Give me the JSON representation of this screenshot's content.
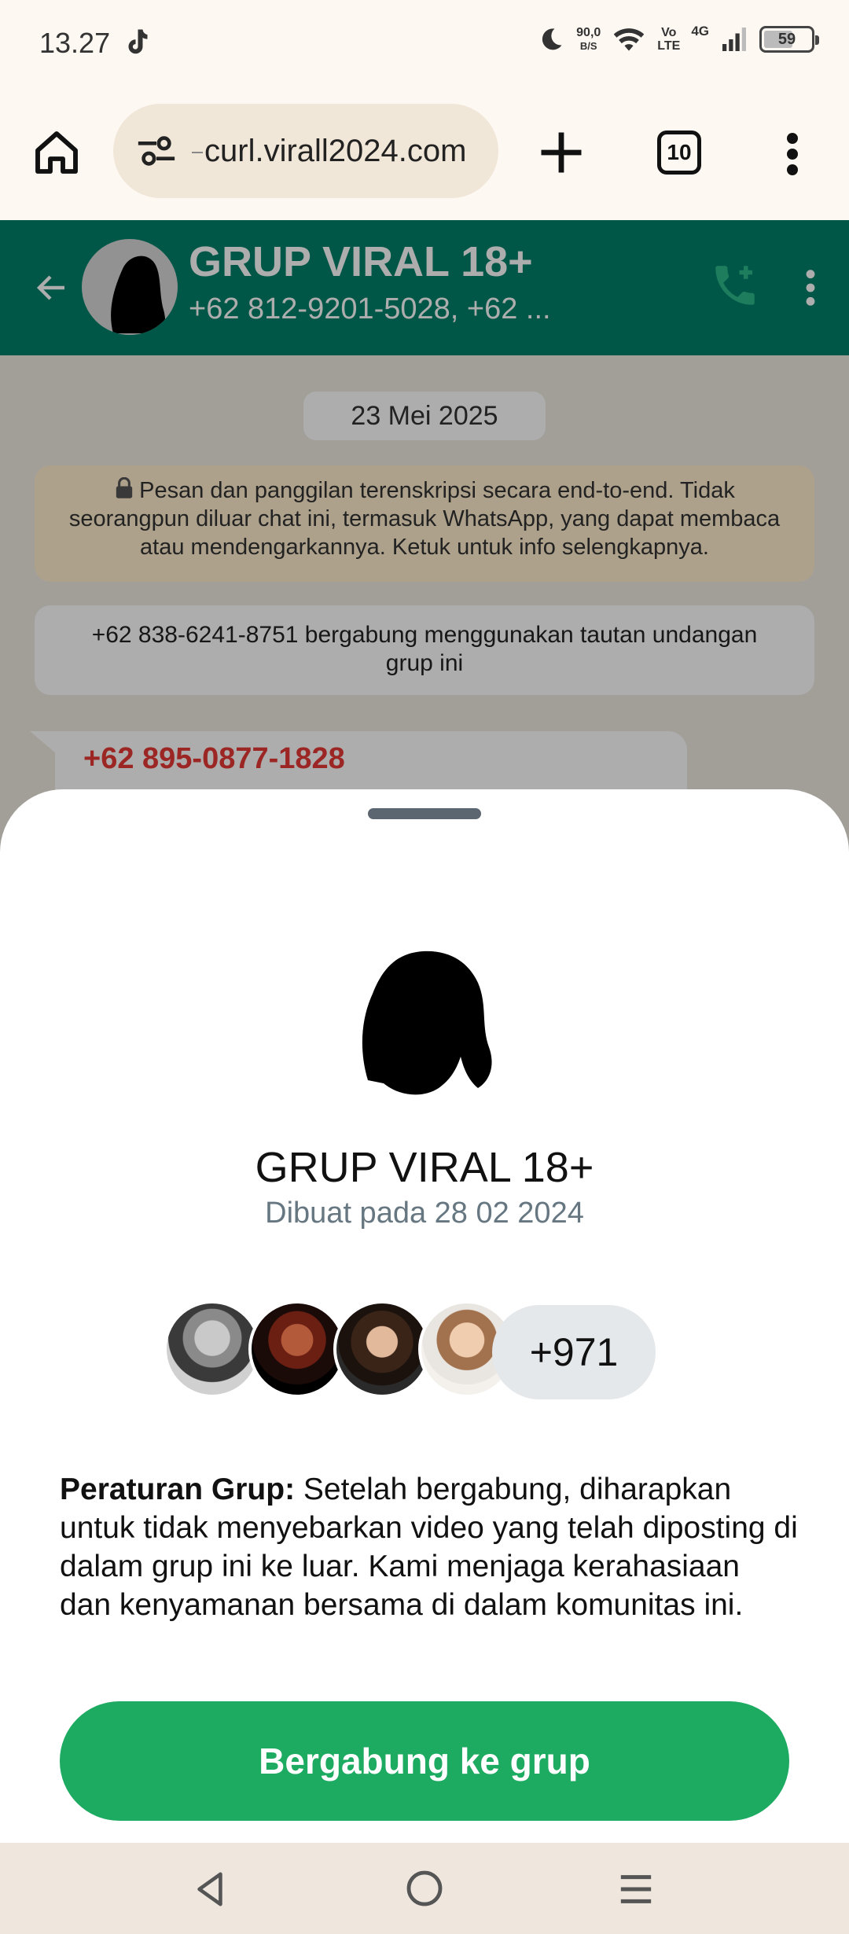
{
  "status_bar": {
    "time": "13.27",
    "net_speed_value": "90,0",
    "net_speed_unit": "B/S",
    "volte_top": "Vo",
    "volte_bottom": "LTE",
    "network": "4G",
    "battery": "59"
  },
  "browser": {
    "url": "curl.virall2024.com",
    "tab_count": "10"
  },
  "chat": {
    "group_name": "GRUP VIRAL 18+",
    "participants": "+62 812-9201-5028, +62 ...",
    "date_chip": "23 Mei 2025",
    "encryption_notice": "Pesan dan panggilan terenskripsi secara end-to-end. Tidak seorangpun diluar chat ini, termasuk WhatsApp, yang dapat membaca atau mendengarkannya. Ketuk untuk info selengkapnya.",
    "join_notice": "+62 838-6241-8751 bergabung menggunakan tautan undangan grup ini",
    "message_sender": "+62 895-0877-1828"
  },
  "sheet": {
    "group_name": "GRUP VIRAL 18+",
    "created": "Dibuat pada 28 02 2024",
    "member_extra_count": "+971",
    "rules_label": "Peraturan Grup:",
    "rules_text": " Setelah bergabung, diharapkan untuk tidak menyebarkan video yang telah diposting di dalam grup ini ke luar. Kami menjaga kerahasiaan dan kenyamanan bersama di dalam komunitas ini.",
    "join_button": "Bergabung ke grup"
  },
  "colors": {
    "whatsapp_header": "#008069",
    "join_button": "#1daa61",
    "sender_name": "#e53935"
  },
  "icons": [
    "tiktok-icon",
    "moon-icon",
    "wifi-icon",
    "signal-icon",
    "battery-icon",
    "home-icon",
    "tune-icon",
    "plus-icon",
    "tabs-icon",
    "more-vert-icon",
    "back-arrow-icon",
    "add-call-icon",
    "lock-icon",
    "nav-back-icon",
    "nav-home-icon",
    "nav-recent-icon"
  ]
}
